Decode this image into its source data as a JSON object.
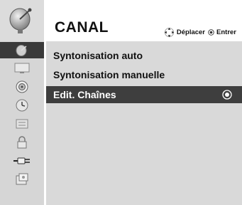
{
  "header": {
    "title": "CANAL",
    "help_move": "Déplacer",
    "help_enter": "Entrer"
  },
  "icons": {
    "header": "satellite-dish-icon",
    "sidebar": [
      "channel-icon",
      "picture-icon",
      "audio-icon",
      "clock-icon",
      "option-icon",
      "lock-icon",
      "input-icon",
      "usb-icon"
    ]
  },
  "menu": {
    "items": [
      {
        "label": "Syntonisation auto"
      },
      {
        "label": "Syntonisation manuelle"
      },
      {
        "label": "Edit. Chaînes"
      }
    ],
    "selected_index": 2
  },
  "colors": {
    "selected_bg": "#3e3e3e",
    "content_bg": "#d9d9d9",
    "sidebar_bg": "#d6d6d6"
  }
}
